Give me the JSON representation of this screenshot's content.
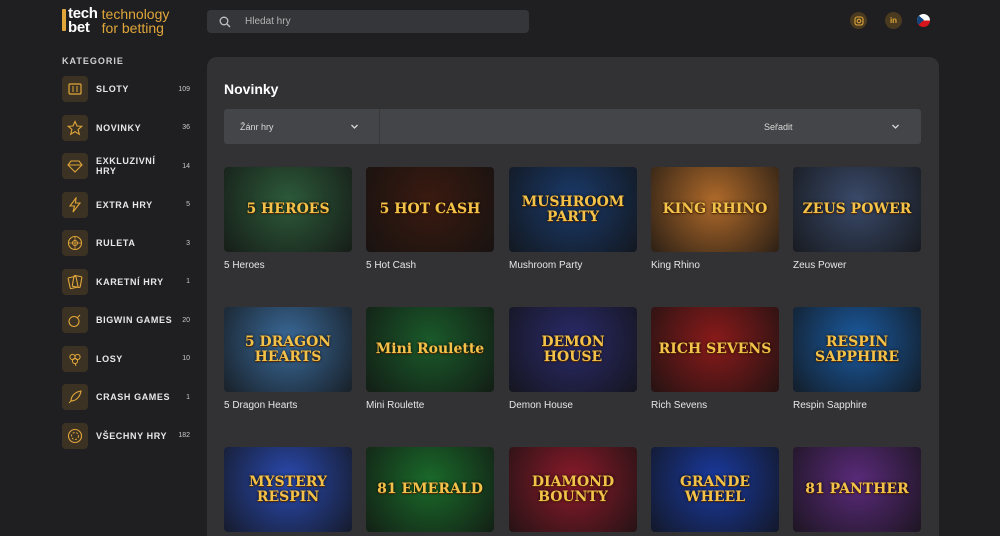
{
  "logo": {
    "line1": "tech",
    "line2": "bet",
    "tag1": "technology",
    "tag2": "for betting"
  },
  "search": {
    "placeholder": "Hledat hry"
  },
  "social": {
    "instagram": "instagram-icon",
    "linkedin": "in"
  },
  "sidebar": {
    "title": "KATEGORIE",
    "items": [
      {
        "label": "SLOTY",
        "count": "109",
        "icon": "slot-machine-icon"
      },
      {
        "label": "NOVINKY",
        "count": "36",
        "icon": "star-icon"
      },
      {
        "label": "EXKLUZIVNÍ HRY",
        "count": "14",
        "icon": "diamond-icon"
      },
      {
        "label": "EXTRA HRY",
        "count": "5",
        "icon": "lightning-icon"
      },
      {
        "label": "RULETA",
        "count": "3",
        "icon": "roulette-icon"
      },
      {
        "label": "KARETNÍ HRY",
        "count": "1",
        "icon": "cards-icon"
      },
      {
        "label": "BIGWIN GAMES",
        "count": "20",
        "icon": "bomb-icon"
      },
      {
        "label": "LOSY",
        "count": "10",
        "icon": "clover-icon"
      },
      {
        "label": "CRASH GAMES",
        "count": "1",
        "icon": "rocket-icon"
      },
      {
        "label": "VŠECHNY HRY",
        "count": "182",
        "icon": "chip-icon"
      }
    ]
  },
  "main": {
    "title": "Novinky",
    "genre_label": "Žánr hry",
    "sort_label": "Seřadit",
    "games": [
      {
        "name": "5 Heroes",
        "art": "5 HEROES",
        "bg": "#2d5a3a"
      },
      {
        "name": "5 Hot Cash",
        "art": "5 HOT CASH",
        "bg": "#3a1a10"
      },
      {
        "name": "Mushroom Party",
        "art": "MUSHROOM PARTY",
        "bg": "#1a3a6a"
      },
      {
        "name": "King Rhino",
        "art": "KING RHINO",
        "bg": "#b06a2a"
      },
      {
        "name": "Zeus Power",
        "art": "ZEUS POWER",
        "bg": "#3a4a6a"
      },
      {
        "name": "5 Dragon Hearts",
        "art": "5 DRAGON HEARTS",
        "bg": "#3a6a9a"
      },
      {
        "name": "Mini Roulette",
        "art": "Mini Roulette",
        "bg": "#1a5a2a"
      },
      {
        "name": "Demon House",
        "art": "DEMON HOUSE",
        "bg": "#2a2a6a"
      },
      {
        "name": "Rich Sevens",
        "art": "RICH SEVENS",
        "bg": "#8a1a1a"
      },
      {
        "name": "Respin Sapphire",
        "art": "RESPIN SAPPHIRE",
        "bg": "#1a5aa0"
      },
      {
        "name": "",
        "art": "MYSTERY RESPIN",
        "bg": "#2a4ab0"
      },
      {
        "name": "",
        "art": "81 EMERALD",
        "bg": "#1a6a2a"
      },
      {
        "name": "",
        "art": "DIAMOND BOUNTY",
        "bg": "#8a1a2a"
      },
      {
        "name": "",
        "art": "GRANDE WHEEL",
        "bg": "#1a3aa0"
      },
      {
        "name": "",
        "art": "81 PANTHER",
        "bg": "#5a2a7a"
      }
    ]
  }
}
